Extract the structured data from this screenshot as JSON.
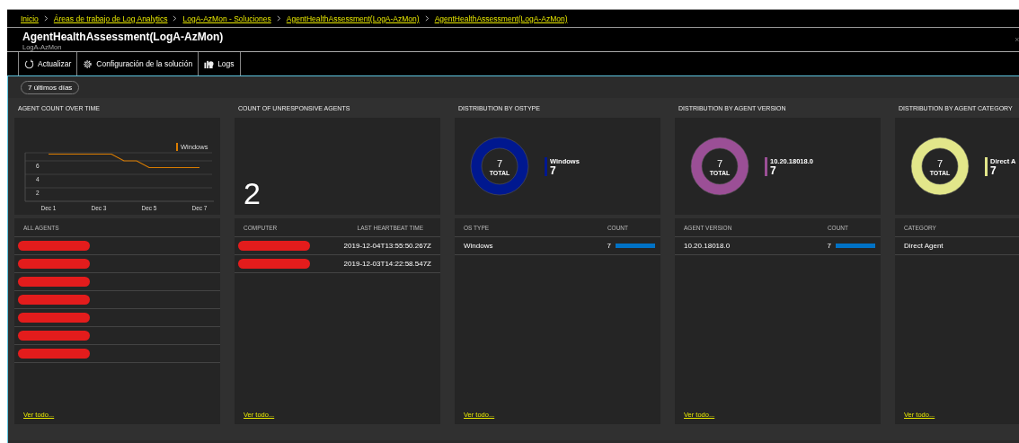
{
  "breadcrumbs": [
    {
      "label": "Inicio"
    },
    {
      "label": "Áreas de trabajo de Log Analytics"
    },
    {
      "label": "LogA-AzMon - Soluciones"
    },
    {
      "label": "AgentHealthAssessment(LogA-AzMon)"
    },
    {
      "label": "AgentHealthAssessment(LogA-AzMon)"
    }
  ],
  "blade": {
    "title": "AgentHealthAssessment(LogA-AzMon)",
    "subtitle": "LogA-AzMon"
  },
  "toolbar": [
    {
      "kind": "refresh",
      "label": "Actualizar"
    },
    {
      "kind": "gear",
      "label": "Configuración de la solución"
    },
    {
      "kind": "logs",
      "label": "Logs"
    }
  ],
  "time_filter": "7 últimos días",
  "tiles": [
    {
      "kind": "chart",
      "title": "AGENT COUNT OVER TIME",
      "chart_data": {
        "type": "line",
        "categories": [
          "Dec 1",
          null,
          null,
          null,
          "Dec 3",
          null,
          null,
          null,
          "Dec 5",
          null,
          null,
          null,
          "Dec 7"
        ],
        "series": [
          {
            "name": "Windows",
            "color": "#d97c00",
            "values": [
              7,
              7,
              7,
              7,
              7,
              7,
              6,
              6,
              5,
              5,
              5,
              5,
              5
            ]
          }
        ],
        "ylim": [
          0,
          7.2
        ],
        "yticks": [
          2,
          4,
          6
        ],
        "grid": true
      },
      "table": {
        "columns": [
          "ALL AGENTS"
        ],
        "rows": [
          {
            "redacted": true
          },
          {
            "redacted": true
          },
          {
            "redacted": true
          },
          {
            "redacted": true
          },
          {
            "redacted": true
          },
          {
            "redacted": true
          },
          {
            "redacted": true
          }
        ]
      },
      "link": "Ver todo..."
    },
    {
      "kind": "number",
      "title": "COUNT OF UNRESPONSIVE AGENTS",
      "value": "2",
      "table": {
        "columns": [
          "COMPUTER",
          "LAST HEARTBEAT TIME"
        ],
        "rows": [
          {
            "redacted": true,
            "time": "2019-12-04T13:55:50.267Z"
          },
          {
            "redacted": true,
            "time": "2019-12-03T14:22:58.547Z"
          }
        ]
      },
      "link": "Ver todo..."
    },
    {
      "kind": "donut",
      "title": "DISTRIBUTION BY OSTYPE",
      "center": {
        "value": "7",
        "label": "TOTAL"
      },
      "legend": [
        {
          "label": "Windows",
          "value": "7",
          "color": "#00188f"
        }
      ],
      "table": {
        "columns": [
          "OS TYPE",
          "COUNT"
        ],
        "rows": [
          {
            "name": "Windows",
            "count": "7",
            "level": 1
          }
        ]
      },
      "link": "Ver todo..."
    },
    {
      "kind": "donut",
      "title": "DISTRIBUTION BY AGENT VERSION",
      "center": {
        "value": "7",
        "label": "TOTAL"
      },
      "legend": [
        {
          "label": "10.20.18018.0",
          "value": "7",
          "color": "#9b4f96"
        }
      ],
      "table": {
        "columns": [
          "AGENT VERSION",
          "COUNT"
        ],
        "rows": [
          {
            "name": "10.20.18018.0",
            "count": "7",
            "level": 1
          }
        ]
      },
      "link": "Ver todo..."
    },
    {
      "kind": "donut",
      "title": "DISTRIBUTION BY AGENT CATEGORY",
      "center": {
        "value": "7",
        "label": "TOTAL"
      },
      "legend": [
        {
          "label": "Direct A",
          "value": "7",
          "color": "#e2e68a"
        }
      ],
      "table": {
        "columns": [
          "CATEGORY"
        ],
        "rows": [
          {
            "name": "Direct Agent"
          }
        ]
      },
      "link": "Ver todo..."
    }
  ]
}
